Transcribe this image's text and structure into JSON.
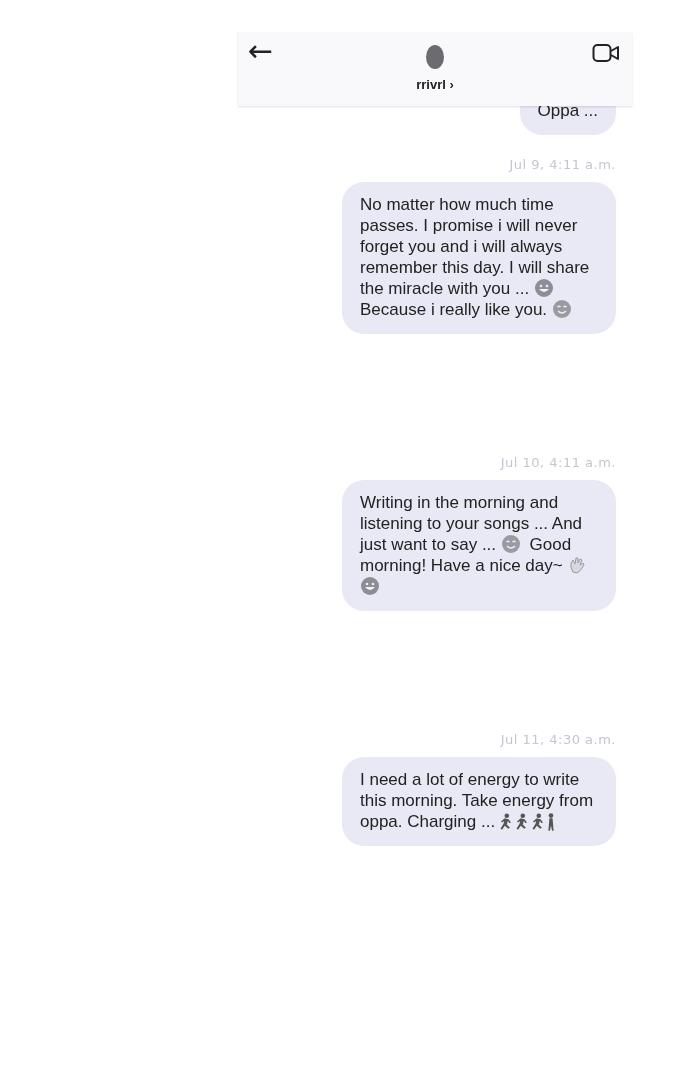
{
  "header": {
    "back": "←",
    "name": "rrivrl",
    "chevron": "›"
  },
  "messages": [
    {
      "parts": [
        {
          "kind": "text",
          "text": "Oppa ..."
        }
      ]
    },
    {
      "time": "Jul 9, 4:11 a.m.",
      "parts": [
        {
          "kind": "text",
          "text": "No matter how much time passes. I promise i will never forget you and i will always remember this day. I will share the miracle with you ... "
        },
        {
          "kind": "grin"
        },
        {
          "kind": "text",
          "text": " Because i really like you. "
        },
        {
          "kind": "smile"
        }
      ]
    },
    {
      "time": "Jul 10, 4:11 a.m.",
      "parts": [
        {
          "kind": "text",
          "text": "Writing in the morning and listening to your songs ... And just want to say ... "
        },
        {
          "kind": "smile"
        },
        {
          "kind": "text",
          "text": " Good morning! Have a nice day~ "
        },
        {
          "kind": "wave"
        },
        {
          "kind": "grin"
        }
      ]
    },
    {
      "time": "Jul 11, 4:30 a.m.",
      "parts": [
        {
          "kind": "text",
          "text": "I need a lot of energy to write this morning. Take energy from oppa. Charging ... "
        },
        {
          "kind": "runner"
        },
        {
          "kind": "runner"
        },
        {
          "kind": "runner"
        },
        {
          "kind": "walker"
        }
      ]
    }
  ]
}
